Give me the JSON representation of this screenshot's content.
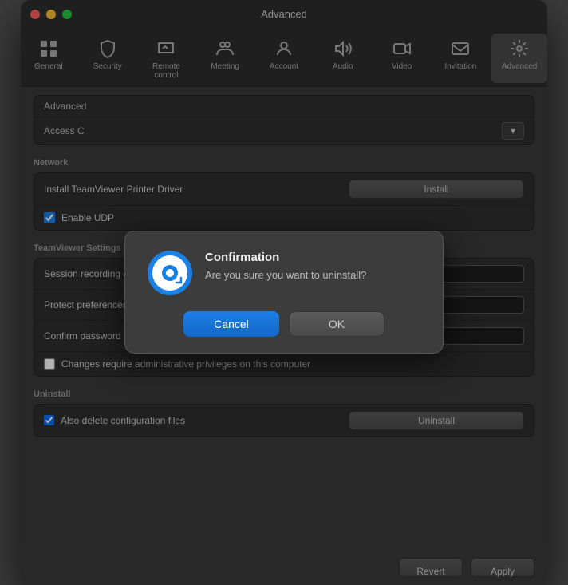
{
  "window": {
    "title": "Advanced"
  },
  "toolbar": {
    "items": [
      {
        "id": "general",
        "label": "General",
        "icon": "⊞"
      },
      {
        "id": "security",
        "label": "Security",
        "icon": "🛡"
      },
      {
        "id": "remote-control",
        "label": "Remote control",
        "icon": "🖱"
      },
      {
        "id": "meeting",
        "label": "Meeting",
        "icon": "👥"
      },
      {
        "id": "account",
        "label": "Account",
        "icon": "👤"
      },
      {
        "id": "audio",
        "label": "Audio",
        "icon": "🔊"
      },
      {
        "id": "video",
        "label": "Video",
        "icon": "🎥"
      },
      {
        "id": "invitation",
        "label": "Invitation",
        "icon": "✉"
      },
      {
        "id": "advanced",
        "label": "Advanced",
        "icon": "⚙"
      }
    ]
  },
  "advanced_section": {
    "header": "Advanced",
    "access_label": "Access C"
  },
  "network_section": {
    "header": "Network",
    "install_label": "Install TeamViewer Printer Driver",
    "install_btn": "Install",
    "udp_label": "Enable UDP",
    "udp_checked": true
  },
  "teamviewer_settings_section": {
    "header": "TeamViewer Settings",
    "rows": [
      {
        "label": "Session recording directory",
        "value": ""
      },
      {
        "label": "Protect preferences with password",
        "value": ""
      },
      {
        "label": "Confirm password",
        "value": ""
      }
    ],
    "admin_label": "Changes require administrative privileges on this computer",
    "admin_checked": false
  },
  "uninstall_section": {
    "header": "Uninstall",
    "delete_label": "Also delete configuration files",
    "delete_checked": true,
    "uninstall_btn": "Uninstall"
  },
  "bottom_bar": {
    "revert_label": "Revert",
    "apply_label": "Apply"
  },
  "modal": {
    "title": "Confirmation",
    "message": "Are you sure you want to uninstall?",
    "cancel_label": "Cancel",
    "ok_label": "OK"
  }
}
